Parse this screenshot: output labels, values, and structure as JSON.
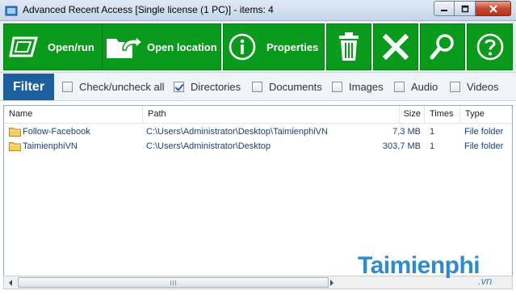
{
  "window": {
    "title": "Advanced Recent Access [Single license (1 PC)] - items: 4",
    "controls": [
      "minimize-icon",
      "maximize-icon",
      "close-icon"
    ]
  },
  "toolbar": {
    "open_run_label": "Open/run",
    "open_location_label": "Open location",
    "properties_label": "Properties",
    "icons": [
      "open-run-icon",
      "open-location-icon",
      "info-icon",
      "trash-icon",
      "close-x-icon",
      "search-icon",
      "help-icon"
    ],
    "accent_color": "#0a9b1c"
  },
  "filter": {
    "title": "Filter",
    "options": [
      {
        "label": "Check/uncheck all",
        "checked": false
      },
      {
        "label": "Directories",
        "checked": true
      },
      {
        "label": "Documents",
        "checked": false
      },
      {
        "label": "Images",
        "checked": false
      },
      {
        "label": "Audio",
        "checked": false
      },
      {
        "label": "Videos",
        "checked": false
      }
    ],
    "title_bg": "#1c5f9c"
  },
  "list": {
    "columns": [
      "Name",
      "Path",
      "Size",
      "Times",
      "Type"
    ],
    "rows": [
      {
        "name": "Follow-Facebook",
        "path": "C:\\Users\\Administrator\\Desktop\\TaimienphiVN",
        "size": "7,3 MB",
        "times": "1",
        "type": "File folder"
      },
      {
        "name": "TaimienphiVN",
        "path": "C:\\Users\\Administrator\\Desktop",
        "size": "303,7 MB",
        "times": "1",
        "type": "File folder"
      }
    ]
  },
  "watermark": {
    "brand": "Taimienphi",
    "suffix": ".vn"
  }
}
